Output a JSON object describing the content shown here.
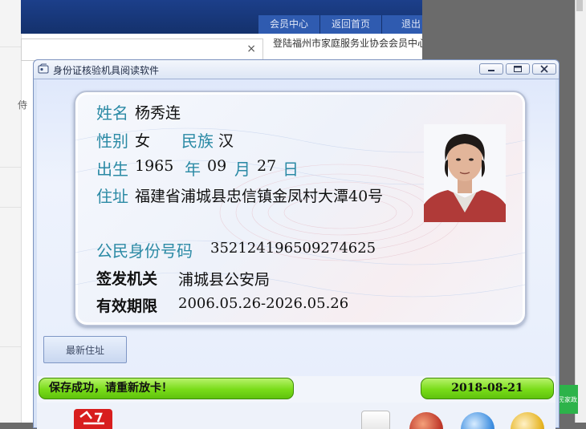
{
  "background": {
    "nav": [
      "会员中心",
      "返回首页",
      "退出"
    ],
    "welcome": "登陆福州市家庭服务业协会会员中心",
    "left_fragment": "侍",
    "dialog_close": "×",
    "badge": "福州为民家政"
  },
  "window": {
    "title": "身份证核验机具阅读软件",
    "controls": [
      "minimize",
      "maximize",
      "close"
    ]
  },
  "card": {
    "name_label": "姓名",
    "name": "杨秀连",
    "sex_label": "性别",
    "sex": "女",
    "ethnic_label": "民族",
    "ethnic": "汉",
    "birth_label": "出生",
    "birth_year": "1965",
    "year_label": "年",
    "birth_month": "09",
    "month_label": "月",
    "birth_day": "27",
    "day_label": "日",
    "address_label": "住址",
    "address": "福建省浦城县忠信镇金凤村大潭40号",
    "id_label": "公民身份号码",
    "id_number": "352124196509274625",
    "authority_label": "签发机关",
    "authority": "浦城县公安局",
    "validity_label": "有效期限",
    "validity": "2006.05.26-2026.05.26"
  },
  "buttons": {
    "latest_address": "最新住址"
  },
  "status": {
    "message": "保存成功，请重新放卡！",
    "date": "2018-08-21"
  },
  "colors": {
    "label_teal": "#2b8aa5",
    "status_green": "#79dc19",
    "window_blue": "#d6e2f6"
  }
}
